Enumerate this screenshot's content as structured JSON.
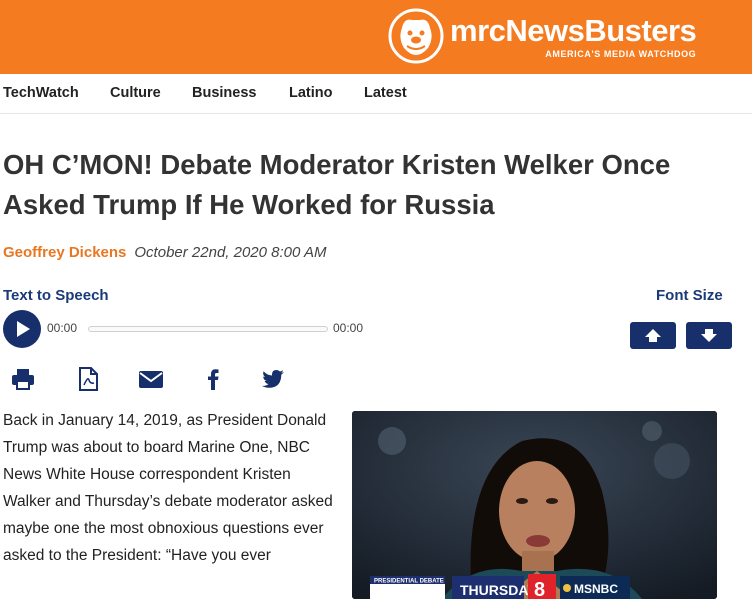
{
  "header": {
    "logo_prefix": "mrc",
    "logo_name": "NewsBusters",
    "logo_tagline": "AMERICA'S MEDIA WATCHDOG",
    "brand_color": "#f47b20"
  },
  "nav": {
    "items": [
      "TechWatch",
      "Culture",
      "Business",
      "Latino",
      "Latest"
    ]
  },
  "article": {
    "title": "OH C’MON! Debate Moderator Kristen Welker Once Asked Trump If He Worked for Russia",
    "author": "Geoffrey Dickens",
    "date": "October 22nd, 2020 8:00 AM",
    "body": "Back in January 14, 2019, as President Donald Trump was about to board Marine One, NBC News White House correspondent Kristen Walker and Thursday’s debate moderator asked maybe one the most obnoxious questions ever asked to the President: “Have you ever"
  },
  "tts": {
    "label": "Text to Speech",
    "current_time": "00:00",
    "duration": "00:00",
    "progress": 0
  },
  "font_size": {
    "label": "Font Size",
    "increase_icon": "arrow-up-icon",
    "decrease_icon": "arrow-down-icon"
  },
  "share_icons": [
    "print-icon",
    "pdf-icon",
    "email-icon",
    "facebook-icon",
    "twitter-icon"
  ],
  "photo": {
    "banner_left": "PRESIDENTIAL DEBATE",
    "banner_day": "THURSDAY",
    "banner_time": "8",
    "banner_network": "MSNBC"
  },
  "colors": {
    "accent_orange": "#e87722",
    "navy": "#17306b",
    "link_blue": "#1a3a78"
  }
}
